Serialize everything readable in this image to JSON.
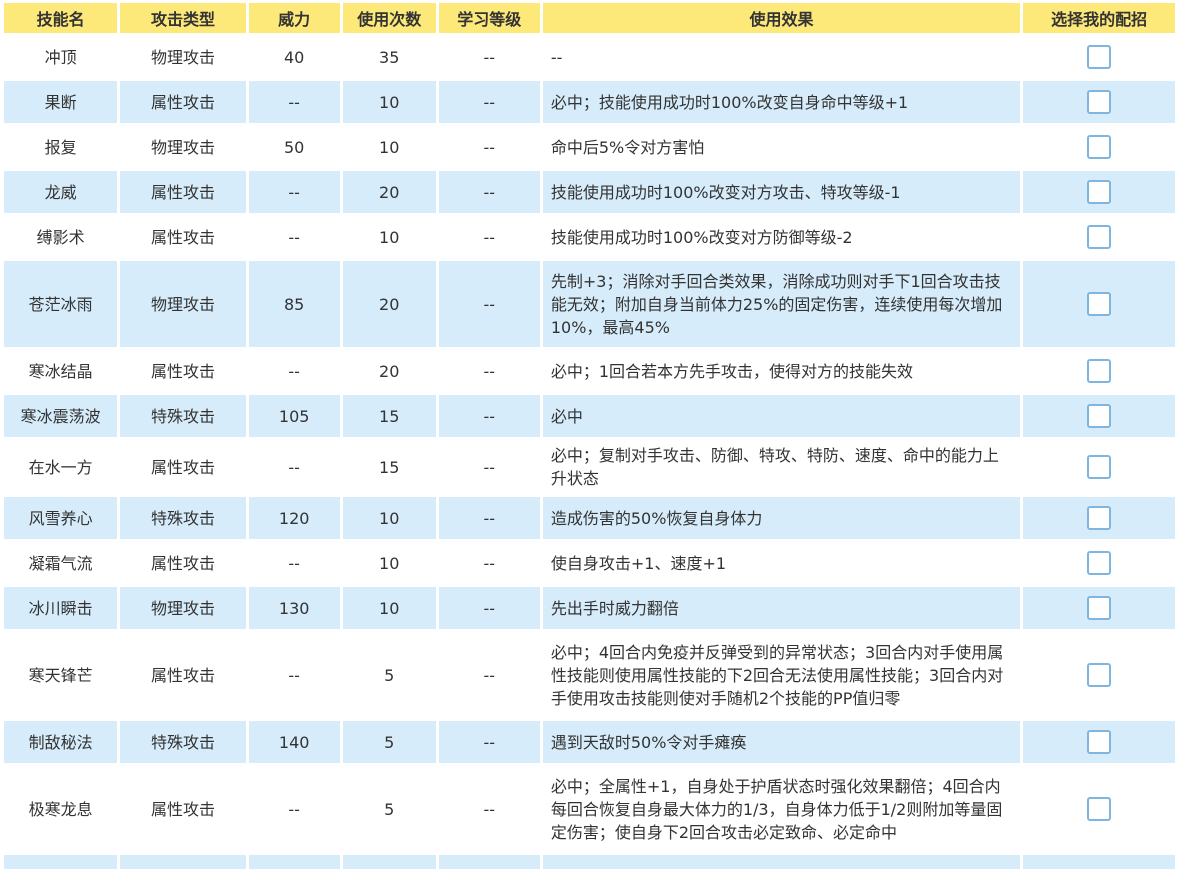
{
  "headers": [
    "技能名",
    "攻击类型",
    "威力",
    "使用次数",
    "学习等级",
    "使用效果",
    "选择我的配招"
  ],
  "rows": [
    {
      "name": "冲顶",
      "type": "物理攻击",
      "power": "40",
      "pp": "35",
      "level": "--",
      "effect": "--",
      "h": "h1"
    },
    {
      "name": "果断",
      "type": "属性攻击",
      "power": "--",
      "pp": "10",
      "level": "--",
      "effect": "必中；技能使用成功时100%改变自身命中等级+1",
      "h": "h1"
    },
    {
      "name": "报复",
      "type": "物理攻击",
      "power": "50",
      "pp": "10",
      "level": "--",
      "effect": "命中后5%令对方害怕",
      "h": "h1"
    },
    {
      "name": "龙威",
      "type": "属性攻击",
      "power": "--",
      "pp": "20",
      "level": "--",
      "effect": "技能使用成功时100%改变对方攻击、特攻等级-1",
      "h": "h1"
    },
    {
      "name": "缚影术",
      "type": "属性攻击",
      "power": "--",
      "pp": "10",
      "level": "--",
      "effect": "技能使用成功时100%改变对方防御等级-2",
      "h": "h1"
    },
    {
      "name": "苍茫冰雨",
      "type": "物理攻击",
      "power": "85",
      "pp": "20",
      "level": "--",
      "effect": "先制+3；消除对手回合类效果，消除成功则对手下1回合攻击技能无效；附加自身当前体力25%的固定伤害，连续使用每次增加10%，最高45%",
      "h": "h3"
    },
    {
      "name": "寒冰结晶",
      "type": "属性攻击",
      "power": "--",
      "pp": "20",
      "level": "--",
      "effect": "必中；1回合若本方先手攻击，使得对方的技能失效",
      "h": "h1"
    },
    {
      "name": "寒冰震荡波",
      "type": "特殊攻击",
      "power": "105",
      "pp": "15",
      "level": "--",
      "effect": "必中",
      "h": "h1"
    },
    {
      "name": "在水一方",
      "type": "属性攻击",
      "power": "--",
      "pp": "15",
      "level": "--",
      "effect": "必中；复制对手攻击、防御、特攻、特防、速度、命中的能力上升状态",
      "h": "h2"
    },
    {
      "name": "风雪养心",
      "type": "特殊攻击",
      "power": "120",
      "pp": "10",
      "level": "--",
      "effect": "造成伤害的50%恢复自身体力",
      "h": "h1"
    },
    {
      "name": "凝霜气流",
      "type": "属性攻击",
      "power": "--",
      "pp": "10",
      "level": "--",
      "effect": "使自身攻击+1、速度+1",
      "h": "h1"
    },
    {
      "name": "冰川瞬击",
      "type": "物理攻击",
      "power": "130",
      "pp": "10",
      "level": "--",
      "effect": "先出手时威力翻倍",
      "h": "h1"
    },
    {
      "name": "寒天锋芒",
      "type": "属性攻击",
      "power": "--",
      "pp": "5",
      "level": "--",
      "effect": "必中；4回合内免疫并反弹受到的异常状态；3回合内对手使用属性技能则使用属性技能的下2回合无法使用属性技能；3回合内对手使用攻击技能则使对手随机2个技能的PP值归零",
      "h": "h3"
    },
    {
      "name": "制敌秘法",
      "type": "特殊攻击",
      "power": "140",
      "pp": "5",
      "level": "--",
      "effect": "遇到天敌时50%令对手瘫痪",
      "h": "h1"
    },
    {
      "name": "极寒龙息",
      "type": "属性攻击",
      "power": "--",
      "pp": "5",
      "level": "--",
      "effect": "必中；全属性+1，自身处于护盾状态时强化效果翻倍；4回合内每回合恢复自身最大体力的1/3，自身体力低于1/2则附加等量固定伤害；使自身下2回合攻击必定致命、必定命中",
      "h": "h3"
    },
    {
      "name": "",
      "type": "",
      "power": "",
      "pp": "",
      "level": "",
      "effect": "",
      "h": "hpeek"
    }
  ]
}
